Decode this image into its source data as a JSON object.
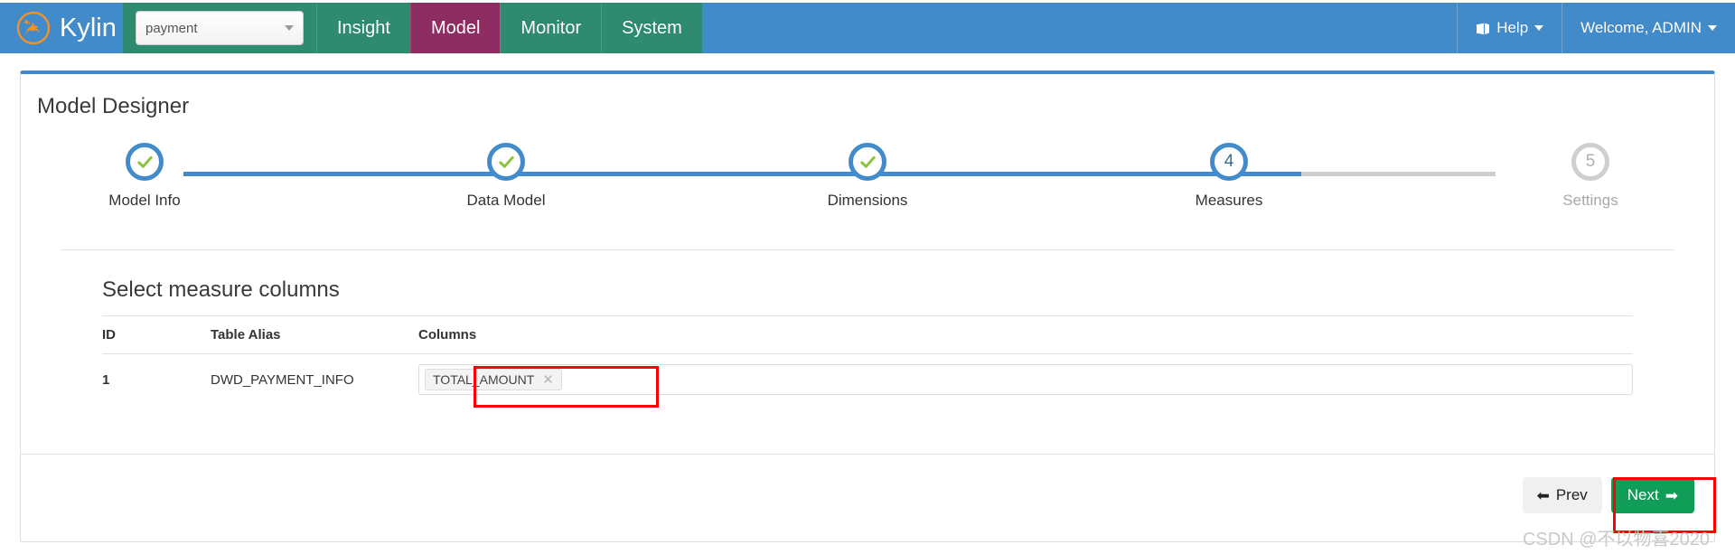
{
  "navbar": {
    "brand": "Kylin",
    "brand_logo_icon": "kylin-creature-logo",
    "project_select": {
      "value": "payment",
      "caret_icon": "caret-down-icon"
    },
    "items": [
      {
        "label": "Insight",
        "active": false
      },
      {
        "label": "Model",
        "active": true
      },
      {
        "label": "Monitor",
        "active": false
      },
      {
        "label": "System",
        "active": false
      }
    ],
    "help": {
      "label": "Help",
      "icon": "book-icon",
      "caret_icon": "caret-down-icon"
    },
    "user": {
      "label": "Welcome, ADMIN",
      "caret_icon": "caret-down-icon"
    },
    "colors": {
      "brand_blue": "#428bca",
      "nav_green": "#2e8b6f",
      "active_purple": "#8e2d62"
    }
  },
  "panel": {
    "title": "Model Designer"
  },
  "stepper": {
    "steps": [
      {
        "num": "1",
        "label": "Model Info",
        "state": "done"
      },
      {
        "num": "2",
        "label": "Data Model",
        "state": "done"
      },
      {
        "num": "3",
        "label": "Dimensions",
        "state": "done"
      },
      {
        "num": "4",
        "label": "Measures",
        "state": "active"
      },
      {
        "num": "5",
        "label": "Settings",
        "state": "todo"
      }
    ],
    "active_index": 4,
    "colors": {
      "active": "#428bca",
      "inactive": "#cfcfcf",
      "check": "#8cc63f"
    }
  },
  "section": {
    "heading": "Select measure columns",
    "table": {
      "headers": [
        "ID",
        "Table Alias",
        "Columns"
      ],
      "rows": [
        {
          "id": "1",
          "table_alias": "DWD_PAYMENT_INFO",
          "columns": [
            {
              "label": "TOTAL_AMOUNT",
              "remove_icon": "close-x-icon"
            }
          ]
        }
      ]
    }
  },
  "footer": {
    "prev_label": "Prev",
    "prev_icon": "arrow-left-icon",
    "next_label": "Next",
    "next_icon": "arrow-right-icon",
    "next_color": "#0f9d58"
  },
  "annotations": {
    "color": "#ff0000",
    "boxes": [
      "measure-column-chip",
      "next-button"
    ]
  },
  "watermark": "CSDN @不以物喜2020"
}
